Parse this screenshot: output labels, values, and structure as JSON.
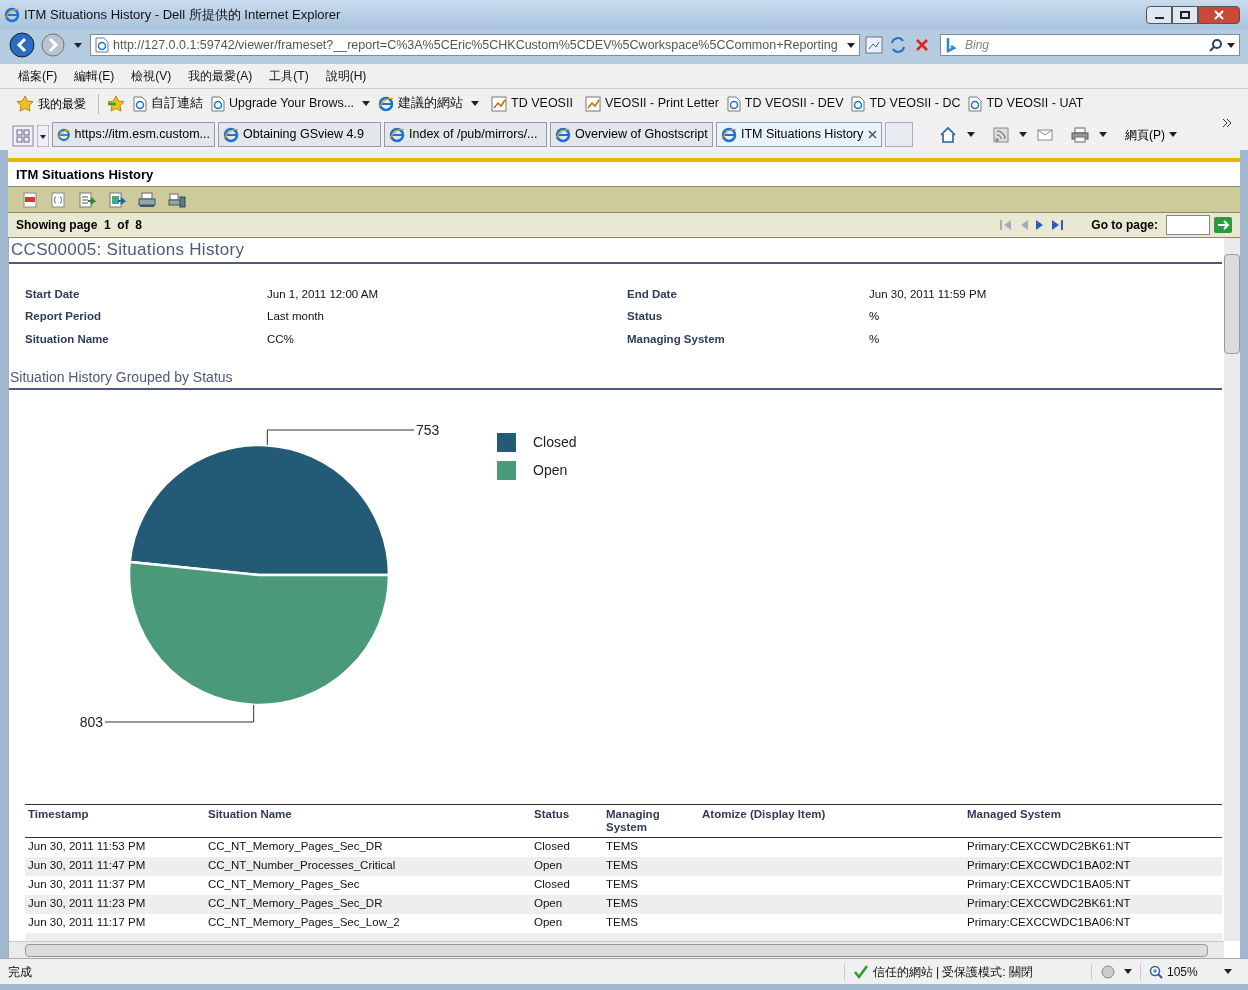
{
  "window": {
    "title": "ITM Situations History - Dell 所提供的 Internet Explorer"
  },
  "address_bar": {
    "url": "http://127.0.0.1:59742/viewer/frameset?__report=C%3A%5CEric%5CHKCustom%5CDEV%5Cworkspace%5CCommon+Reporting",
    "search_placeholder": "Bing"
  },
  "menu": [
    "檔案(F)",
    "編輯(E)",
    "檢視(V)",
    "我的最愛(A)",
    "工具(T)",
    "說明(H)"
  ],
  "favorites_bar": {
    "label": "我的最愛",
    "items": [
      {
        "label": "自訂連結",
        "kind": "page",
        "dropdown": false
      },
      {
        "label": "Upgrade Your Brows...",
        "kind": "page",
        "dropdown": true
      },
      {
        "label": "建議的網站",
        "kind": "ie",
        "dropdown": true
      },
      {
        "label": "TD VEOSII",
        "kind": "chart",
        "dropdown": false
      },
      {
        "label": "VEOSII - Print Letter",
        "kind": "chart",
        "dropdown": false
      },
      {
        "label": "TD VEOSII - DEV",
        "kind": "page",
        "dropdown": false
      },
      {
        "label": "TD VEOSII - DC",
        "kind": "page",
        "dropdown": false
      },
      {
        "label": "TD VEOSII - UAT",
        "kind": "page",
        "dropdown": false
      }
    ]
  },
  "tabs": [
    {
      "label": "https://itm.esm.custom...",
      "selected": false
    },
    {
      "label": "Obtaining GSview 4.9",
      "selected": false
    },
    {
      "label": "Index of /pub/mirrors/...",
      "selected": false
    },
    {
      "label": "Overview of Ghostscript",
      "selected": false
    },
    {
      "label": "ITM Situations History",
      "selected": true
    }
  ],
  "command_bar": {
    "page_menu": "網頁(P)"
  },
  "viewer": {
    "title": "ITM Situations History",
    "paging": {
      "text": "Showing page",
      "page": "1",
      "of": "of",
      "total": "8",
      "goto_label": "Go to page:"
    }
  },
  "report": {
    "title": "CCS00005: Situations History",
    "parameters": [
      {
        "label": "Start Date",
        "value": "Jun 1, 2011 12:00 AM"
      },
      {
        "label": "End Date",
        "value": "Jun 30, 2011 11:59 PM"
      },
      {
        "label": "Report Period",
        "value": "Last month"
      },
      {
        "label": "Status",
        "value": "%"
      },
      {
        "label": "Situation Name",
        "value": "CC%"
      },
      {
        "label": "Managing System",
        "value": "%"
      }
    ],
    "section_title": "Situation History Grouped by Status",
    "chart_data": {
      "type": "pie",
      "categories": [
        "Closed",
        "Open"
      ],
      "values": [
        753,
        803
      ],
      "colors": [
        "#235a75",
        "#4a9a7a"
      ],
      "data_labels": true,
      "legend": "right"
    },
    "table": {
      "columns": [
        "Timestamp",
        "Situation Name",
        "Status",
        "Managing System",
        "Atomize (Display Item)",
        "Managed System"
      ],
      "rows": [
        [
          "Jun 30, 2011 11:53 PM",
          "CC_NT_Memory_Pages_Sec_DR",
          "Closed",
          "TEMS",
          "",
          "Primary:CEXCCWDC2BK61:NT"
        ],
        [
          "Jun 30, 2011 11:47 PM",
          "CC_NT_Number_Processes_Critical",
          "Open",
          "TEMS",
          "",
          "Primary:CEXCCWDC1BA02:NT"
        ],
        [
          "Jun 30, 2011 11:37 PM",
          "CC_NT_Memory_Pages_Sec",
          "Closed",
          "TEMS",
          "",
          "Primary:CEXCCWDC1BA05:NT"
        ],
        [
          "Jun 30, 2011 11:23 PM",
          "CC_NT_Memory_Pages_Sec_DR",
          "Open",
          "TEMS",
          "",
          "Primary:CEXCCWDC2BK61:NT"
        ],
        [
          "Jun 30, 2011 11:17 PM",
          "CC_NT_Memory_Pages_Sec_Low_2",
          "Open",
          "TEMS",
          "",
          "Primary:CEXCCWDC1BA06:NT"
        ]
      ]
    }
  },
  "status_bar": {
    "text": "完成",
    "zone": "信任的網站 | 受保護模式: 關閉",
    "zoom": "105%"
  }
}
